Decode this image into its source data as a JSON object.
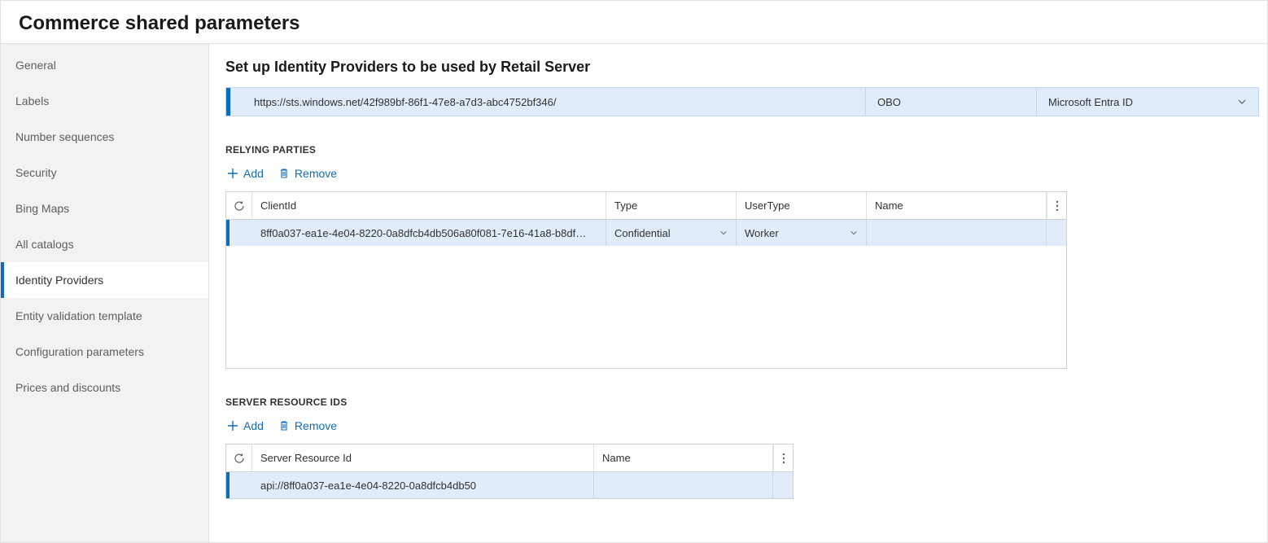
{
  "page": {
    "title": "Commerce shared parameters"
  },
  "sidebar": {
    "items": [
      {
        "label": "General"
      },
      {
        "label": "Labels"
      },
      {
        "label": "Number sequences"
      },
      {
        "label": "Security"
      },
      {
        "label": "Bing Maps"
      },
      {
        "label": "All catalogs"
      },
      {
        "label": "Identity Providers"
      },
      {
        "label": "Entity validation template"
      },
      {
        "label": "Configuration parameters"
      },
      {
        "label": "Prices and discounts"
      }
    ],
    "active_index": 6
  },
  "main": {
    "heading": "Set up Identity Providers to be used by Retail Server",
    "idp_row": {
      "issuer": "https://sts.windows.net/42f989bf-86f1-47e8-a7d3-abc4752bf346/",
      "type": "OBO",
      "name": "Microsoft Entra ID"
    },
    "relying_parties": {
      "title": "RELYING PARTIES",
      "add_label": "Add",
      "remove_label": "Remove",
      "columns": {
        "clientid": "ClientId",
        "type": "Type",
        "usertype": "UserType",
        "name": "Name"
      },
      "rows": [
        {
          "clientid": "8ff0a037-ea1e-4e04-8220-0a8dfcb4db506a80f081-7e16-41a8-b8df…",
          "type": "Confidential",
          "usertype": "Worker",
          "name": ""
        }
      ]
    },
    "server_resource_ids": {
      "title": "SERVER RESOURCE IDS",
      "add_label": "Add",
      "remove_label": "Remove",
      "columns": {
        "srid": "Server Resource Id",
        "name": "Name"
      },
      "rows": [
        {
          "srid": "api://8ff0a037-ea1e-4e04-8220-0a8dfcb4db50",
          "name": ""
        }
      ]
    }
  }
}
